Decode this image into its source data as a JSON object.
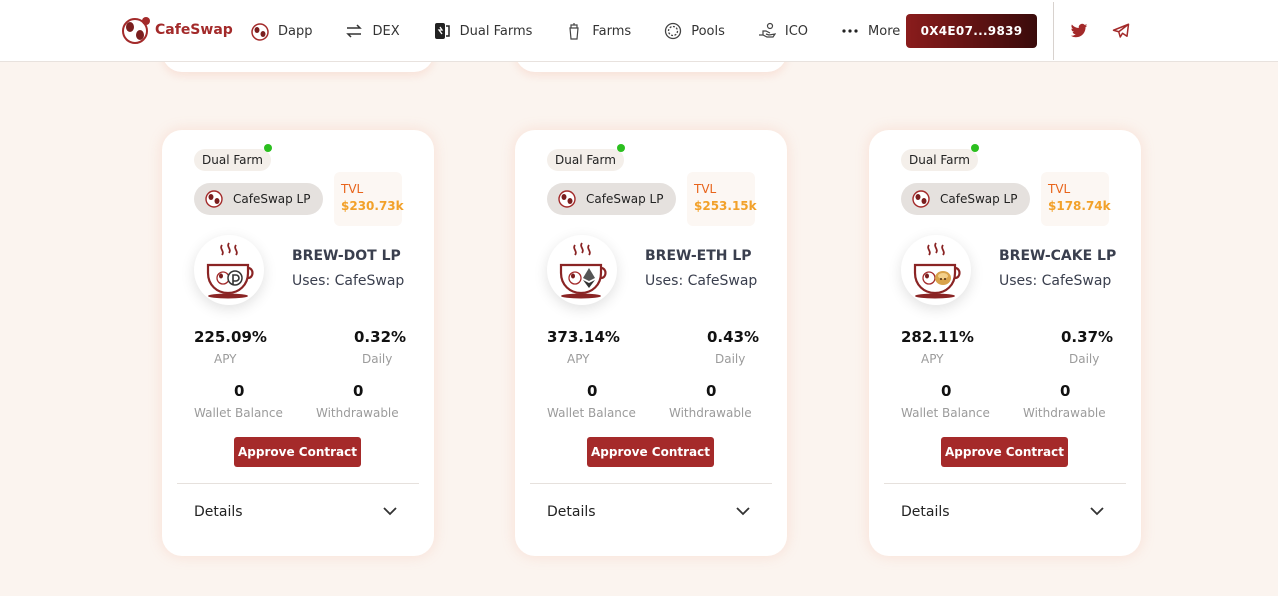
{
  "header": {
    "brand": "CafeSwap",
    "nav": [
      {
        "label": "Dapp",
        "icon": "cup-icon"
      },
      {
        "label": "DEX",
        "icon": "swap-arrows-icon"
      },
      {
        "label": "Dual Farms",
        "icon": "dual-farm-icon"
      },
      {
        "label": "Farms",
        "icon": "farm-icon"
      },
      {
        "label": "Pools",
        "icon": "pool-icon"
      },
      {
        "label": "ICO",
        "icon": "ico-hand-icon"
      },
      {
        "label": "More",
        "icon": "more-dots-icon"
      }
    ],
    "wallet_address": "0X4E07...9839",
    "social": [
      "twitter-icon",
      "telegram-icon"
    ]
  },
  "colors": {
    "accent": "#a52a2a",
    "tvl_label": "#e8641b",
    "tvl_value": "#f2a12a",
    "online_dot": "#2bbf1f"
  },
  "cards": [
    {
      "badge": "Dual Farm",
      "lp_label": "CafeSwap LP",
      "tvl_label": "TVL",
      "tvl_value": "$230.73k",
      "token_name": "BREW-DOT LP",
      "uses": "Uses: CafeSwap",
      "apy_value": "225.09%",
      "apy_label": "APY",
      "daily_value": "0.32%",
      "daily_label": "Daily",
      "wallet_value": "0",
      "wallet_label": "Wallet Balance",
      "withdraw_value": "0",
      "withdraw_label": "Withdrawable",
      "approve_label": "Approve Contract",
      "details_label": "Details"
    },
    {
      "badge": "Dual Farm",
      "lp_label": "CafeSwap LP",
      "tvl_label": "TVL",
      "tvl_value": "$253.15k",
      "token_name": "BREW-ETH LP",
      "uses": "Uses: CafeSwap",
      "apy_value": "373.14%",
      "apy_label": "APY",
      "daily_value": "0.43%",
      "daily_label": "Daily",
      "wallet_value": "0",
      "wallet_label": "Wallet Balance",
      "withdraw_value": "0",
      "withdraw_label": "Withdrawable",
      "approve_label": "Approve Contract",
      "details_label": "Details"
    },
    {
      "badge": "Dual Farm",
      "lp_label": "CafeSwap LP",
      "tvl_label": "TVL",
      "tvl_value": "$178.74k",
      "token_name": "BREW-CAKE LP",
      "uses": "Uses: CafeSwap",
      "apy_value": "282.11%",
      "apy_label": "APY",
      "daily_value": "0.37%",
      "daily_label": "Daily",
      "wallet_value": "0",
      "wallet_label": "Wallet Balance",
      "withdraw_value": "0",
      "withdraw_label": "Withdrawable",
      "approve_label": "Approve Contract",
      "details_label": "Details"
    }
  ]
}
